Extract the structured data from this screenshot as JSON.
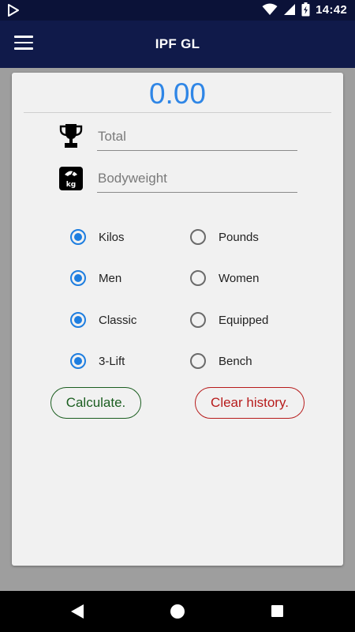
{
  "status_bar": {
    "time": "14:42",
    "icons": [
      "play-store-icon",
      "wifi-icon",
      "cell-signal-icon",
      "battery-charging-icon"
    ]
  },
  "app_bar": {
    "title": "IPF GL",
    "menu_icon": "hamburger-menu-icon"
  },
  "score": {
    "value": "0.00"
  },
  "fields": {
    "total": {
      "placeholder": "Total",
      "value": "",
      "icon": "trophy-icon"
    },
    "bodyweight": {
      "placeholder": "Bodyweight",
      "value": "",
      "icon": "scale-kg-icon",
      "icon_text": "kg"
    }
  },
  "options": {
    "units": {
      "selected": "Kilos",
      "choices": [
        "Kilos",
        "Pounds"
      ]
    },
    "sex": {
      "selected": "Men",
      "choices": [
        "Men",
        "Women"
      ]
    },
    "equipment": {
      "selected": "Classic",
      "choices": [
        "Classic",
        "Equipped"
      ]
    },
    "event": {
      "selected": "3-Lift",
      "choices": [
        "3-Lift",
        "Bench"
      ]
    }
  },
  "buttons": {
    "calculate": "Calculate.",
    "clear_history": "Clear history."
  },
  "colors": {
    "status_bar": "#0b1238",
    "app_bar": "#101a4a",
    "accent": "#1e7ee0",
    "score_text": "#2f86e6",
    "calculate": "#1b5e20",
    "clear_history": "#b71c1c",
    "card": "#f1f1f1",
    "background": "#9e9e9e"
  },
  "nav_bar": {
    "icons": [
      "back-icon",
      "home-icon",
      "recents-icon"
    ]
  }
}
